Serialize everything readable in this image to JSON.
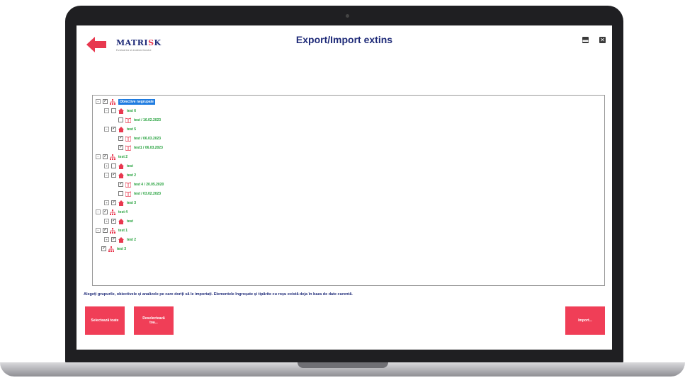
{
  "header": {
    "title": "Export/Import extins",
    "logo_name_a": "MATRI",
    "logo_name_accent": "S",
    "logo_name_b": "K",
    "logo_tagline": "Evaluarea si analiza riscului",
    "minimize_glyph": "▬",
    "close_glyph": "✕"
  },
  "tree": {
    "rows": [
      {
        "level": 0,
        "expander": "⊟",
        "checked": true,
        "icon": "sitemap-icon",
        "label": "Obiective negrupate",
        "selected": true
      },
      {
        "level": 1,
        "expander": "⊟",
        "checked": false,
        "icon": "home-icon",
        "label": "test 6"
      },
      {
        "level": 2,
        "expander": "",
        "checked": false,
        "icon": "book-icon",
        "label": "test / 16.02.2023"
      },
      {
        "level": 1,
        "expander": "⊟",
        "checked": true,
        "icon": "home-icon",
        "label": "test 5"
      },
      {
        "level": 2,
        "expander": "",
        "checked": true,
        "icon": "book-icon",
        "label": "test / 06.03.2023"
      },
      {
        "level": 2,
        "expander": "",
        "checked": true,
        "icon": "book-icon",
        "label": "test1 / 06.03.2023"
      },
      {
        "level": 0,
        "expander": "⊟",
        "checked": true,
        "icon": "sitemap-icon",
        "label": "test 2"
      },
      {
        "level": 1,
        "expander": "⊞",
        "checked": false,
        "icon": "home-icon",
        "label": "test"
      },
      {
        "level": 1,
        "expander": "⊟",
        "checked": true,
        "icon": "home-icon",
        "label": "test 2"
      },
      {
        "level": 2,
        "expander": "",
        "checked": true,
        "icon": "book-icon",
        "label": "test 4 / 20.05.2020"
      },
      {
        "level": 2,
        "expander": "",
        "checked": false,
        "icon": "book-icon",
        "label": "test / 03.02.2023"
      },
      {
        "level": 1,
        "expander": "⊞",
        "checked": true,
        "icon": "home-icon",
        "label": "test 3"
      },
      {
        "level": 0,
        "expander": "⊟",
        "checked": true,
        "icon": "sitemap-icon",
        "label": "test 4"
      },
      {
        "level": 1,
        "expander": "⊞",
        "checked": true,
        "icon": "home-icon",
        "label": "test"
      },
      {
        "level": 0,
        "expander": "⊟",
        "checked": true,
        "icon": "sitemap-icon",
        "label": "test 1"
      },
      {
        "level": 1,
        "expander": "⊞",
        "checked": true,
        "icon": "home-icon",
        "label": "test 2"
      },
      {
        "level": 0,
        "expander": "",
        "checked": true,
        "icon": "sitemap-icon",
        "label": "test 3"
      }
    ]
  },
  "instructions": "Alegeți grupurile, obiectivele și analizele pe care doriți să le importați. Elementele îngroșate și tipărite cu roșu există deja în baza de date curentă.",
  "buttons": {
    "select_all": "Selectează toate",
    "deselect_all": "Deselectează toa...",
    "import": "Import..."
  },
  "colors": {
    "accent": "#f03e57",
    "navy": "#1e2a78",
    "tree_text": "#22a03a",
    "selection": "#1e7be0"
  }
}
